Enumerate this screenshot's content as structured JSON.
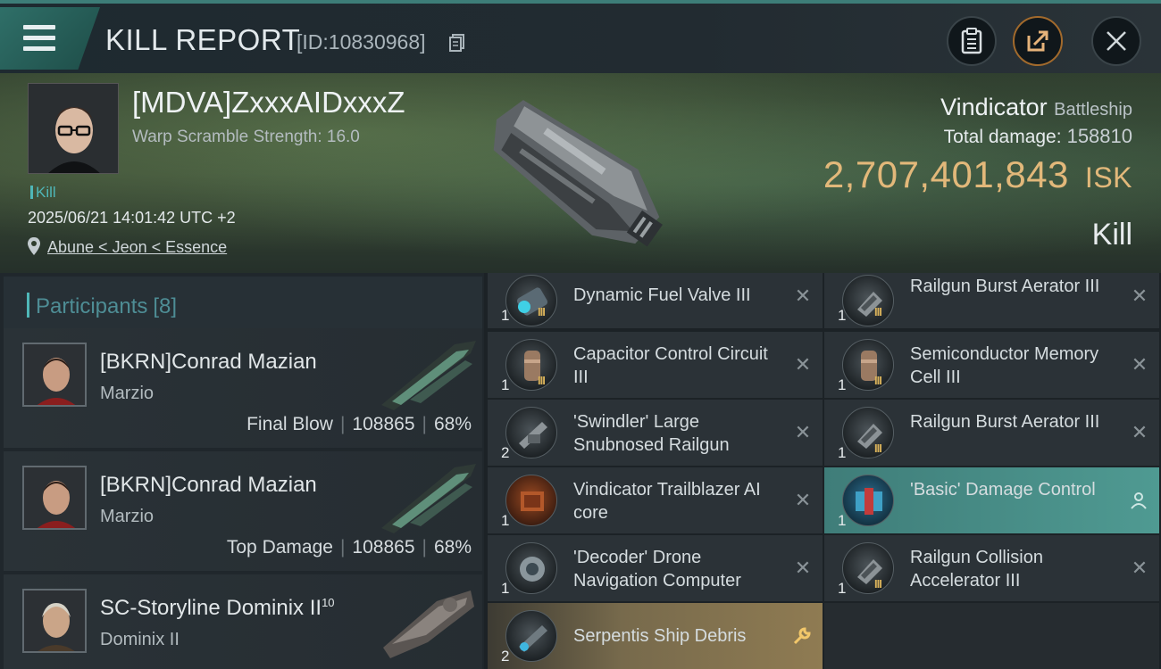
{
  "header": {
    "title": "KILL REPORT",
    "id_label": "[ID:10830968]",
    "icons": [
      "menu-icon",
      "copy-icon",
      "clipboard-icon",
      "share-icon",
      "close-icon"
    ]
  },
  "victim": {
    "name": "[MDVA]ZxxxAIDxxxZ",
    "warp": "Warp Scramble Strength: 16.0",
    "tag": "Kill",
    "datetime": "2025/06/21 14:01:42 UTC +2",
    "location": "Abune < Jeon < Essence",
    "ship_name": "Vindicator",
    "ship_class": "Battleship",
    "damage_label": "Total damage:",
    "damage_value": "158810",
    "isk_value": "2,707,401,843",
    "isk_unit": "ISK",
    "result": "Kill"
  },
  "participants": {
    "title": "Participants",
    "count": "[8]",
    "list": [
      {
        "name": "[BKRN]Conrad Mazian",
        "ship": "Marzio",
        "role": "Final Blow",
        "damage": "108865",
        "pct": "68%"
      },
      {
        "name": "[BKRN]Conrad Mazian",
        "ship": "Marzio",
        "role": "Top Damage",
        "damage": "108865",
        "pct": "68%"
      },
      {
        "name": "SC-Storyline Dominix II",
        "name_sup": "10",
        "ship": "Dominix II"
      }
    ]
  },
  "items": [
    {
      "name": "Dynamic Fuel Valve III",
      "qty": "1",
      "tier": "III"
    },
    {
      "name": "Railgun Burst Aerator III",
      "qty": "1",
      "tier": "III"
    },
    {
      "name": "Capacitor Control Circuit III",
      "qty": "1",
      "tier": "III"
    },
    {
      "name": "Semiconductor Memory Cell III",
      "qty": "1",
      "tier": "III"
    },
    {
      "name": "'Swindler' Large Snubnosed Railgun",
      "qty": "2"
    },
    {
      "name": "Railgun Burst Aerator III",
      "qty": "1",
      "tier": "III"
    },
    {
      "name": "Vindicator Trailblazer AI core",
      "qty": "1"
    },
    {
      "name": "'Basic' Damage Control",
      "qty": "1",
      "status": "person-icon"
    },
    {
      "name": "'Decoder' Drone Navigation Computer",
      "qty": "1"
    },
    {
      "name": "Railgun Collision Accelerator III",
      "qty": "1",
      "tier": "III"
    },
    {
      "name": "Serpentis Ship Debris",
      "qty": "2",
      "status": "wrench-icon"
    }
  ],
  "colors": {
    "accent": "#4fb7b8",
    "isk": "#e2b87a",
    "teal_row": "#4f9a92",
    "gold_row": "#8f7b52"
  }
}
